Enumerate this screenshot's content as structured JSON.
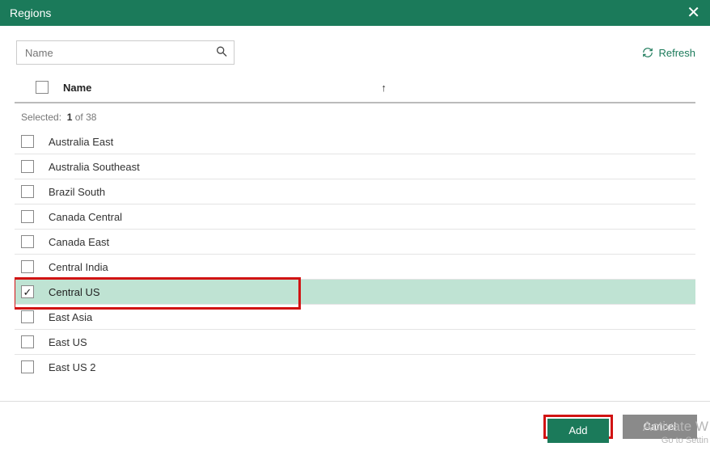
{
  "titlebar": {
    "title": "Regions"
  },
  "toolbar": {
    "search_placeholder": "Name",
    "refresh_label": "Refresh"
  },
  "header": {
    "name_label": "Name",
    "sort_glyph": "↑"
  },
  "selected": {
    "prefix": "Selected:",
    "count": "1",
    "of": "of",
    "total": "38"
  },
  "regions": [
    {
      "label": "Australia East",
      "checked": false,
      "highlighted": false
    },
    {
      "label": "Australia Southeast",
      "checked": false,
      "highlighted": false
    },
    {
      "label": "Brazil South",
      "checked": false,
      "highlighted": false
    },
    {
      "label": "Canada Central",
      "checked": false,
      "highlighted": false
    },
    {
      "label": "Canada East",
      "checked": false,
      "highlighted": false
    },
    {
      "label": "Central India",
      "checked": false,
      "highlighted": false
    },
    {
      "label": "Central US",
      "checked": true,
      "highlighted": true
    },
    {
      "label": "East Asia",
      "checked": false,
      "highlighted": false
    },
    {
      "label": "East US",
      "checked": false,
      "highlighted": false
    },
    {
      "label": "East US 2",
      "checked": false,
      "highlighted": false
    }
  ],
  "footer": {
    "add_label": "Add",
    "cancel_label": "Cancel"
  },
  "watermark": {
    "line1": "Activate W",
    "line2": "Go to Settin"
  },
  "colors": {
    "brand": "#1b7a5a",
    "highlight_bg": "#bfe3d3",
    "red_box": "#d11313",
    "cancel": "#8a8a8a"
  }
}
